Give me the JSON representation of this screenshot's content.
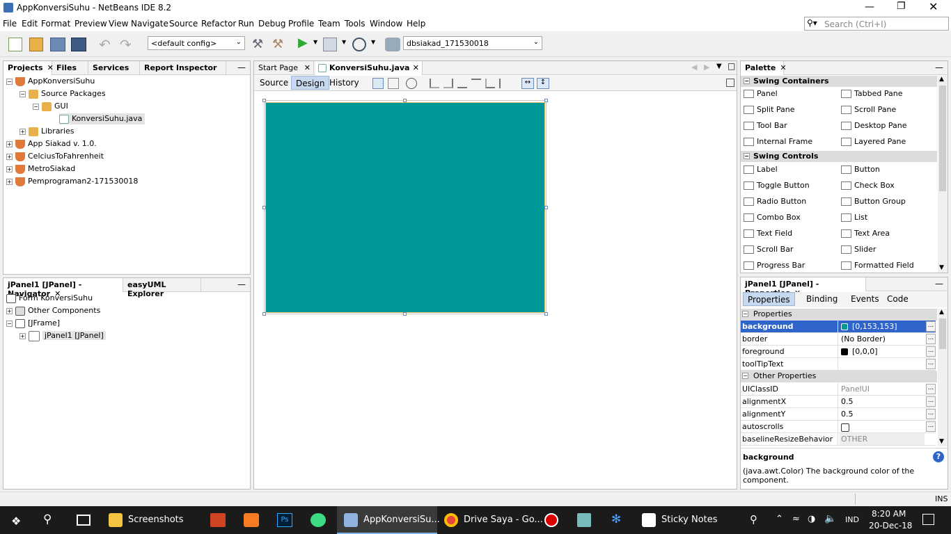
{
  "window": {
    "title": "AppKonversiSuhu - NetBeans IDE 8.2"
  },
  "menu": [
    "File",
    "Edit",
    "Format",
    "Preview",
    "View",
    "Navigate",
    "Source",
    "Refactor",
    "Run",
    "Debug",
    "Profile",
    "Team",
    "Tools",
    "Window",
    "Help"
  ],
  "search": {
    "placeholder": "Search (Ctrl+I)"
  },
  "toolbar": {
    "config": "<default config>",
    "db_combo": "dbsiakad_171530018"
  },
  "projects_panel": {
    "tabs": [
      "Projects",
      "Files",
      "Services",
      "Report Inspector"
    ],
    "tree": {
      "root": "AppKonversiSuhu",
      "source_packages": "Source Packages",
      "gui": "GUI",
      "file": "KonversiSuhu.java",
      "libraries": "Libraries",
      "others": [
        "App Siakad v. 1.0.",
        "CelciusToFahrenheit",
        "MetroSiakad",
        "Pemprograman2-171530018"
      ]
    }
  },
  "navigator_panel": {
    "tabs": [
      "jPanel1 [JPanel] - Navigator",
      "easyUML Explorer"
    ],
    "tree": {
      "form": "Form KonversiSuhu",
      "other": "Other Components",
      "frame": "[JFrame]",
      "panel": "jPanel1 [JPanel]"
    }
  },
  "editor": {
    "tabs": [
      "Start Page",
      "KonversiSuhu.java"
    ],
    "subtabs": [
      "Source",
      "Design",
      "History"
    ],
    "canvas_color": "#009999"
  },
  "palette": {
    "title": "Palette",
    "containers_title": "Swing Containers",
    "containers": [
      [
        "Panel",
        "Tabbed Pane"
      ],
      [
        "Split Pane",
        "Scroll Pane"
      ],
      [
        "Tool Bar",
        "Desktop Pane"
      ],
      [
        "Internal Frame",
        "Layered Pane"
      ]
    ],
    "controls_title": "Swing Controls",
    "controls": [
      [
        "Label",
        "Button"
      ],
      [
        "Toggle Button",
        "Check Box"
      ],
      [
        "Radio Button",
        "Button Group"
      ],
      [
        "Combo Box",
        "List"
      ],
      [
        "Text Field",
        "Text Area"
      ],
      [
        "Scroll Bar",
        "Slider"
      ],
      [
        "Progress Bar",
        "Formatted Field"
      ]
    ]
  },
  "properties": {
    "title": "jPanel1 [JPanel] - Properties",
    "tabs": [
      "Properties",
      "Binding",
      "Events",
      "Code"
    ],
    "section1": "Properties",
    "rows1": [
      [
        "background",
        "[0,153,153]"
      ],
      [
        "border",
        "(No Border)"
      ],
      [
        "foreground",
        "[0,0,0]"
      ],
      [
        "toolTipText",
        ""
      ]
    ],
    "section2": "Other Properties",
    "rows2": [
      [
        "UIClassID",
        "PanelUI"
      ],
      [
        "alignmentX",
        "0.5"
      ],
      [
        "alignmentY",
        "0.5"
      ],
      [
        "autoscrolls",
        ""
      ],
      [
        "baselineResizeBehavior",
        "OTHER"
      ]
    ],
    "help_title": "background",
    "help_text": "(java.awt.Color) The background color of the component."
  },
  "statusbar": {
    "ins": "INS"
  },
  "taskbar": {
    "items": [
      "Screenshots",
      "AppKonversiSu...",
      "Drive Saya - Go...",
      "Sticky Notes"
    ],
    "lang": "IND",
    "time": "8:20 AM",
    "date": "20-Dec-18"
  },
  "colors": {
    "accent": "#2f65ca",
    "canvas": "#009999",
    "taskbar": "#1b1b1b"
  }
}
